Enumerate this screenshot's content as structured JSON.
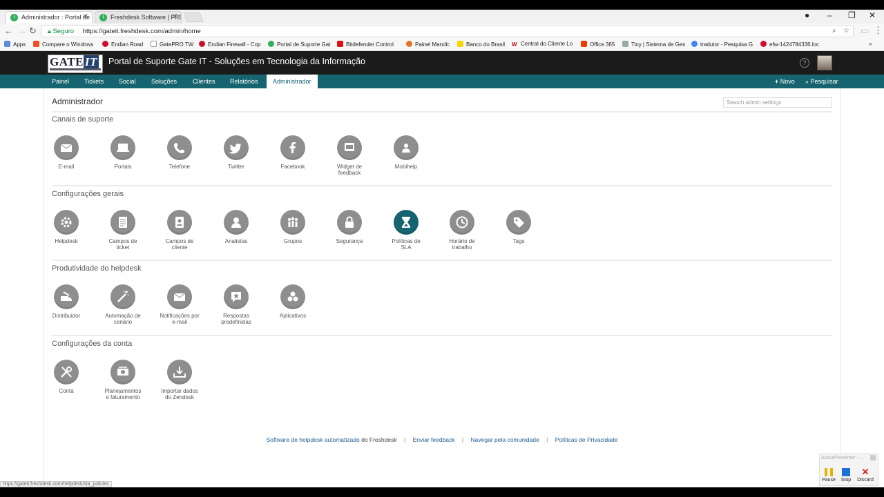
{
  "browser": {
    "tabs": [
      {
        "title": "Administrador : Portal de",
        "active": true
      },
      {
        "title": "Freshdesk Software | FRE",
        "active": false
      }
    ],
    "url_secure_label": "Seguro",
    "url": "https://gateit.freshdesk.com/admin/home",
    "bookmarks": [
      "Apps",
      "Compare o Windows",
      "Endian Road",
      "GatePRO TW",
      "Endian Firewall - Cop",
      "Portal de Suporte Gat",
      "Bitdefender Control",
      "Painel Mandic",
      "Banco do Brasil",
      "Central do Cliente Lo",
      "Office 365",
      "Tiny | Sistema de Ges",
      "tradutor - Pesquisa G",
      "efw-1424784336.loc"
    ],
    "status_url": "https://gateit.freshdesk.com/helpdesk/sla_policies"
  },
  "header": {
    "logo_text": "GATE",
    "logo_it": "IT",
    "title": "Portal de Suporte Gate IT - Soluções em Tecnologia da Informação",
    "nav": [
      "Painel",
      "Tickets",
      "Social",
      "Soluções",
      "Clientes",
      "Relatórios",
      "Administrador"
    ],
    "active_nav": "Administrador",
    "new_label": "Novo",
    "search_label": "Pesquisar"
  },
  "page": {
    "title": "Administrador",
    "search_placeholder": "Search admin settings"
  },
  "sections": [
    {
      "title": "Canais de suporte",
      "items": [
        {
          "l1": "E-mail",
          "l2": "",
          "icon": "email-icon"
        },
        {
          "l1": "Portais",
          "l2": "",
          "icon": "portal-icon"
        },
        {
          "l1": "Telefone",
          "l2": "",
          "icon": "phone-icon"
        },
        {
          "l1": "Twitter",
          "l2": "",
          "icon": "twitter-icon"
        },
        {
          "l1": "Facebook",
          "l2": "",
          "icon": "facebook-icon"
        },
        {
          "l1": "Widget de",
          "l2": "feedback",
          "icon": "widget-icon"
        },
        {
          "l1": "Mobihelp",
          "l2": "",
          "icon": "mobihelp-icon"
        }
      ]
    },
    {
      "title": "Configurações gerais",
      "items": [
        {
          "l1": "Helpdesk",
          "l2": "",
          "icon": "gear-icon"
        },
        {
          "l1": "Campos de",
          "l2": "ticket",
          "icon": "ticket-fields-icon"
        },
        {
          "l1": "Campos de",
          "l2": "cliente",
          "icon": "customer-fields-icon"
        },
        {
          "l1": "Analistas",
          "l2": "",
          "icon": "agent-icon"
        },
        {
          "l1": "Grupos",
          "l2": "",
          "icon": "groups-icon"
        },
        {
          "l1": "Segurança",
          "l2": "",
          "icon": "lock-icon"
        },
        {
          "l1": "Políticas de",
          "l2": "SLA",
          "icon": "hourglass-icon"
        },
        {
          "l1": "Horário de",
          "l2": "trabalho",
          "icon": "clock-icon"
        },
        {
          "l1": "Tags",
          "l2": "",
          "icon": "tag-icon"
        }
      ]
    },
    {
      "title": "Produtividade do helpdesk",
      "items": [
        {
          "l1": "Distribuidor",
          "l2": "",
          "icon": "dispatcher-icon"
        },
        {
          "l1": "Automação de",
          "l2": "cenário",
          "icon": "magic-wand-icon"
        },
        {
          "l1": "Notificações por",
          "l2": "e-mail",
          "icon": "envelope-icon"
        },
        {
          "l1": "Respostas",
          "l2": "predefinidas",
          "icon": "canned-response-icon"
        },
        {
          "l1": "Aplicativos",
          "l2": "",
          "icon": "apps-icon"
        }
      ]
    },
    {
      "title": "Configurações da conta",
      "items": [
        {
          "l1": "Conta",
          "l2": "",
          "icon": "tools-icon"
        },
        {
          "l1": "Planejamentos",
          "l2": "e faturamento",
          "icon": "billing-icon"
        },
        {
          "l1": "Importar dados",
          "l2": "do Zendesk",
          "icon": "import-icon"
        }
      ]
    }
  ],
  "footer": {
    "link1": "Software de helpdesk automatizado",
    "by": " do Freshdesk",
    "link2": "Enviar feedback",
    "link3": "Navegar pela comunidade",
    "link4": "Políticas de Privacidade"
  },
  "activepresenter": {
    "title": "ActivePresenter - ...",
    "pause": "Pause",
    "stop": "Stop",
    "discard": "Discard"
  },
  "colors": {
    "nav_bg": "#156470",
    "header_bg": "#1b1b1b",
    "icon_bg": "#8e8e8e"
  }
}
